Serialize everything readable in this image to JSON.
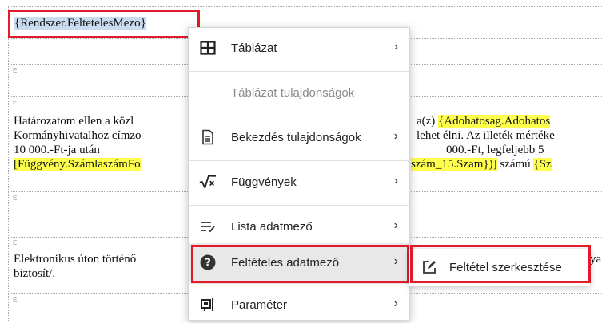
{
  "document": {
    "field_top": "{Rendszer.FeltetelesMezo}",
    "para1_line1_left": "Határozatom ellen a közl",
    "para1_line1_right_prefix": "a(z) ",
    "para1_line1_right_hl": "{Adohatosag.Adohatos",
    "para1_line2_left": "Kormányhivatalhoz címzo",
    "para1_line2_right": "lehet élni. Az illeték mértéke",
    "para1_line3_left": "10     000.-Ft-ja     után",
    "para1_line3_right": "000.-Ft,     legfeljebb     5",
    "para1_line4_left_hl": "[Függvény.SzámlaszámFo",
    "para1_line4_right_hl1": "szám_15.Szam})]",
    "para1_line4_right_mid": " számú ",
    "para1_line4_right_hl2": "{Sz",
    "para2_line1_left": "Elektronikus úton történő",
    "para2_line1_right": "ya",
    "para2_line2_left": "biztosít/.",
    "para_mark": "E|"
  },
  "context_menu": {
    "items": [
      {
        "label": "Táblázat",
        "icon": "table-icon",
        "has_submenu": true,
        "enabled": true
      },
      {
        "label": "Táblázat tulajdonságok",
        "icon": "",
        "has_submenu": false,
        "enabled": false
      },
      {
        "label": "Bekezdés tulajdonságok",
        "icon": "paragraph-properties-icon",
        "has_submenu": true,
        "enabled": true
      },
      {
        "label": "Függvények",
        "icon": "function-sqrt-icon",
        "has_submenu": true,
        "enabled": true
      },
      {
        "label": "Lista adatmező",
        "icon": "list-field-icon",
        "has_submenu": true,
        "enabled": true
      },
      {
        "label": "Feltételes adatmező",
        "icon": "question-circle-icon",
        "has_submenu": true,
        "enabled": true,
        "active": true
      },
      {
        "label": "Paraméter",
        "icon": "parameter-icon",
        "has_submenu": true,
        "enabled": true
      }
    ],
    "chevron": "›"
  },
  "submenu": {
    "items": [
      {
        "label": "Feltétel szerkesztése",
        "icon": "edit-icon"
      }
    ]
  },
  "colors": {
    "highlight": "#ffff4d",
    "selection": "#c9dbef",
    "callout": "#e01b2a",
    "active_item": "#e8e8e8"
  }
}
